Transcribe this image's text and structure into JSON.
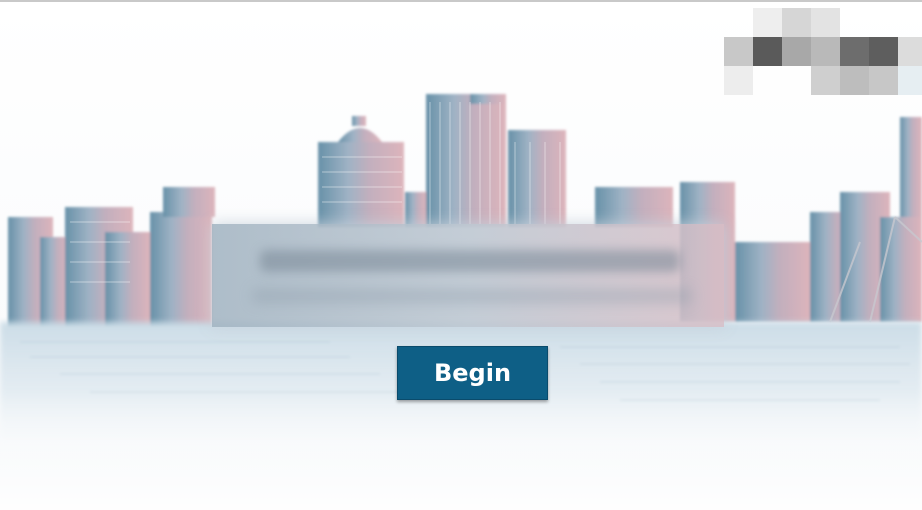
{
  "slide": {
    "begin_label": "Begin"
  },
  "colors": {
    "button_bg": "#0e5f86",
    "button_text": "#ffffff",
    "skyline_blue": "#4e7f9a",
    "skyline_pink": "#d8a8b0"
  },
  "icons": {
    "logo": "pixelated-logo-icon"
  }
}
